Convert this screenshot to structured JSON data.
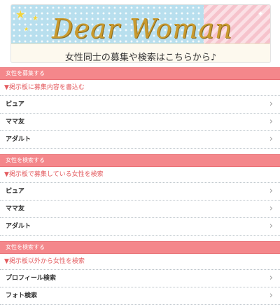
{
  "banner": {
    "title": "Dear Woman",
    "subtitle": "女性同士の募集や検索はこちらから♪"
  },
  "sections": [
    {
      "header": "女性を募集する",
      "sub_label": "▼掲示板に募集内容を書込む",
      "items": [
        "ピュア",
        "ママ友",
        "アダルト"
      ]
    },
    {
      "header": "女性を検索する",
      "sub_label": "▼掲示板で募集している女性を検索",
      "items": [
        "ピュア",
        "ママ友",
        "アダルト"
      ]
    },
    {
      "header": "女性を検索する",
      "sub_label": "▼掲示板以外から女性を検索",
      "items": [
        "プロフィール検索",
        "フォト検索"
      ]
    }
  ],
  "icons": {
    "row_arrow": "chevron-right-icon"
  },
  "colors": {
    "section_header_bg": "#f4878b",
    "sub_label_text": "#e35a5e",
    "banner_bg": "#b8dfee"
  }
}
